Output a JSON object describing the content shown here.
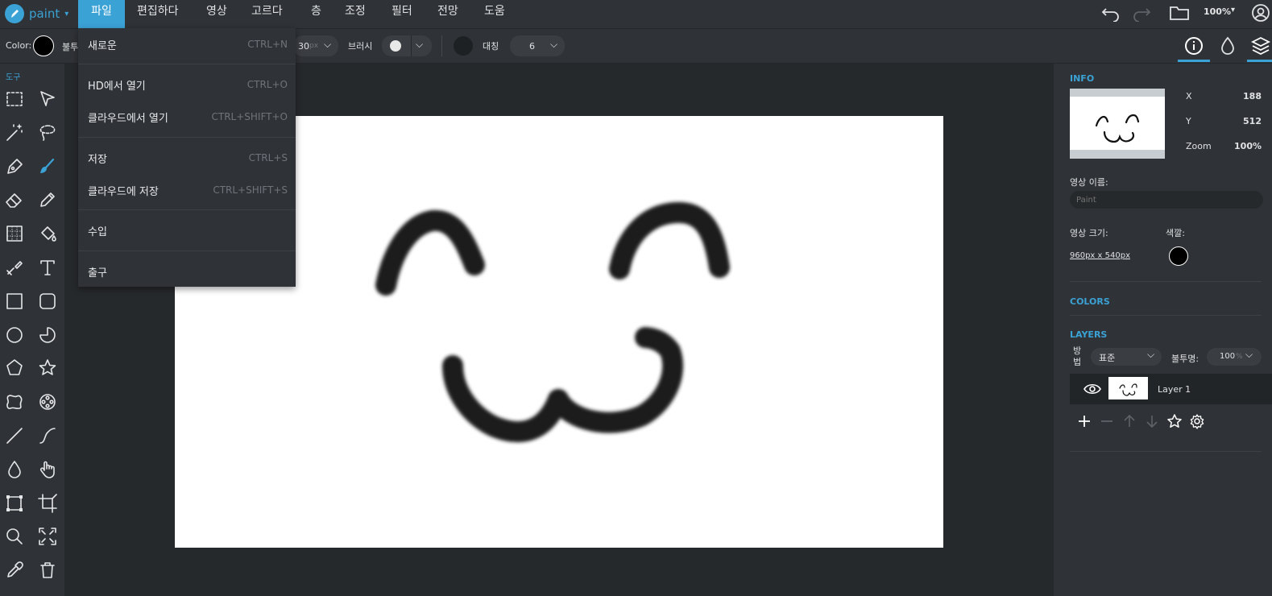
{
  "app": {
    "name": "paint"
  },
  "menubar": {
    "items": [
      "파일",
      "편집하다",
      "영상",
      "고르다",
      "층",
      "조정",
      "필터",
      "전망",
      "도움"
    ],
    "active": "파일",
    "zoom": "100%"
  },
  "toolbar": {
    "color_label": "Color:",
    "color_value": "#000000",
    "opacity_label": "불투",
    "size_value": "30",
    "size_unit": "px",
    "brush_label": "브러시",
    "symmetry_label": "대칭",
    "symmetry_value": "6"
  },
  "tools": {
    "header": "도구",
    "items": [
      [
        "select-rect",
        "arrow"
      ],
      [
        "magic-wand",
        "lasso"
      ],
      [
        "pen",
        "brush"
      ],
      [
        "eraser",
        "pencil"
      ],
      [
        "gradient",
        "fill-bucket"
      ],
      [
        "clone-stamp",
        "text"
      ],
      [
        "rectangle",
        "rounded-rect"
      ],
      [
        "circle",
        "pie"
      ],
      [
        "pentagon",
        "star"
      ],
      [
        "blob",
        "flower"
      ],
      [
        "line",
        "curve"
      ],
      [
        "drop",
        "hand"
      ],
      [
        "transform",
        "crop"
      ],
      [
        "zoom",
        "fullscreen"
      ],
      [
        "eyedropper",
        "trash"
      ]
    ]
  },
  "file_menu": {
    "items": [
      {
        "label": "새로운",
        "shortcut": "CTRL+N"
      },
      {
        "label": "HD에서 열기",
        "shortcut": "CTRL+O"
      },
      {
        "label": "클라우드에서 열기",
        "shortcut": "CTRL+SHIFT+O"
      },
      {
        "label": "저장",
        "shortcut": "CTRL+S"
      },
      {
        "label": "클라우드에 저장",
        "shortcut": "CTRL+SHIFT+S"
      },
      {
        "label": "수입",
        "shortcut": ""
      },
      {
        "label": "출구",
        "shortcut": ""
      }
    ]
  },
  "info": {
    "title": "INFO",
    "x_label": "X",
    "x_value": "188",
    "y_label": "Y",
    "y_value": "512",
    "zoom_label": "Zoom",
    "zoom_value": "100%",
    "image_name_label": "영상 이름:",
    "image_name_placeholder": "Paint",
    "image_size_label": "영상 크기:",
    "image_size_value": "960px x 540px",
    "color_label": "색깔:",
    "color_value": "#000000"
  },
  "colors": {
    "title": "COLORS"
  },
  "layers": {
    "title": "LAYERS",
    "blend_label": "방법",
    "blend_value": "표준",
    "opacity_label": "불투명:",
    "opacity_value": "100",
    "opacity_unit": "%",
    "items": [
      {
        "name": "Layer 1"
      }
    ]
  },
  "colors_accent": {
    "accent": "#3ba2d6",
    "bg": "#2f3236",
    "workspace": "#26292c"
  }
}
